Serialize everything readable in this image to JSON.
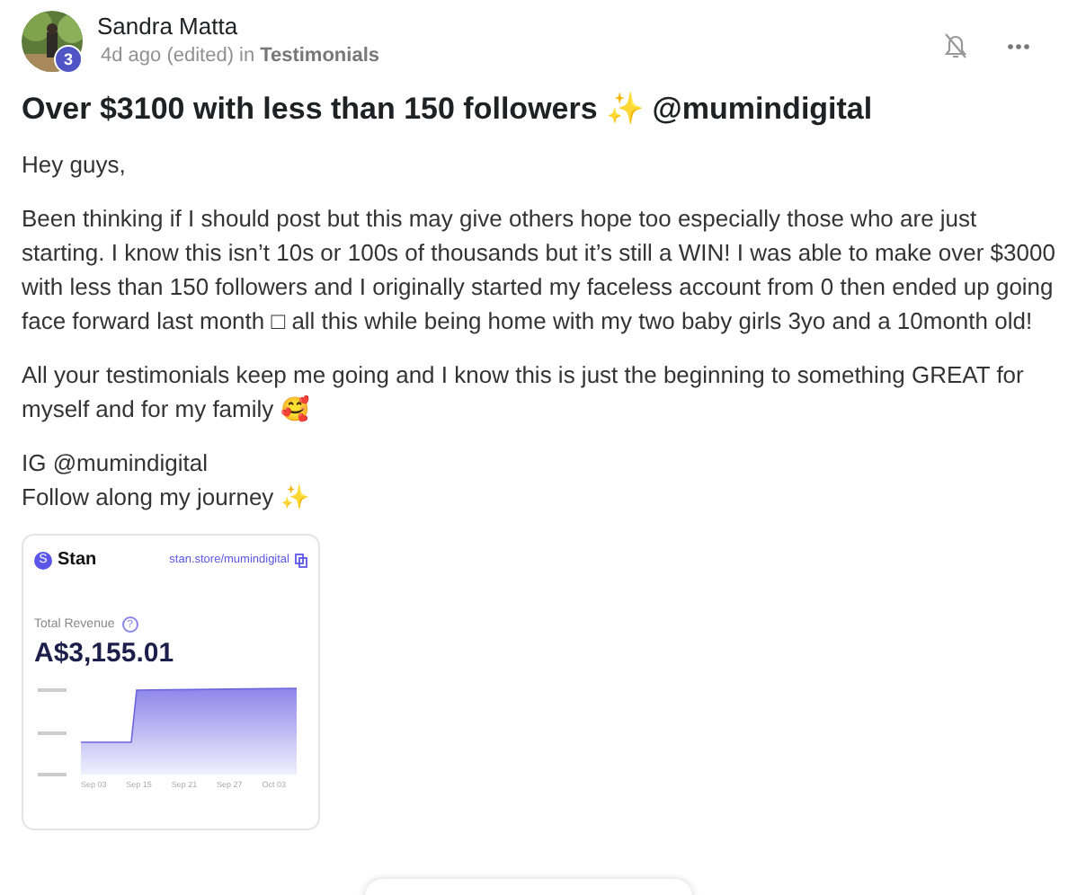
{
  "author": {
    "name": "Sandra Matta",
    "level": "3",
    "time": "4d ago (edited)",
    "in": "in",
    "category": "Testimonials"
  },
  "title": "Over $3100 with less than 150 followers ✨ @mumindigital",
  "paragraphs": [
    {
      "lines": [
        "Hey guys,"
      ]
    },
    {
      "lines": [
        "Been thinking if I should post but this may give others hope too especially those who are just starting. I know this isn’t 10s or 100s of thousands but it’s still a WIN! I was able to make over $3000 with less than 150 followers and I originally started my faceless account from 0 then ended up going face forward last month □ all this while being home with my two baby girls 3yo and a 10month old!"
      ]
    },
    {
      "lines": [
        "All your testimonials keep me going and I know this is just the beginning to something GREAT for myself and for my family 🥰"
      ]
    },
    {
      "lines": [
        "IG @mumindigital",
        "Follow along my journey ✨"
      ]
    }
  ],
  "attachment": {
    "brand_badge": "S",
    "brand": "Stan",
    "link": "stan.store/mumindigital",
    "metric_label": "Total Revenue",
    "metric_help": "?",
    "metric_value": "A$3,155.01",
    "x_labels": [
      "Sep 03",
      "Sep 15",
      "Sep 21",
      "Sep 27",
      "Oct 03"
    ]
  }
}
